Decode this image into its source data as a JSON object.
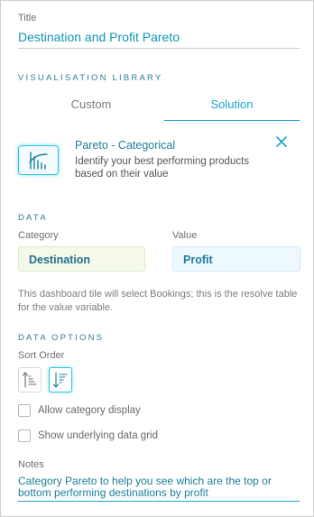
{
  "title": {
    "label": "Title",
    "value": "Destination and Profit Pareto"
  },
  "visualisation": {
    "heading": "VISUALISATION LIBRARY",
    "tabs": [
      {
        "label": "Custom",
        "active": false
      },
      {
        "label": "Solution",
        "active": true
      }
    ],
    "selected": {
      "icon": "pareto-chart-icon",
      "name": "Pareto - Categorical",
      "description": "Identify your best performing products based on their value",
      "close_icon": "close-icon"
    }
  },
  "data": {
    "heading": "DATA",
    "category_label": "Category",
    "category_value": "Destination",
    "value_label": "Value",
    "value_value": "Profit",
    "info": "This dashboard tile will select Bookings; this is the resolve table for the value variable."
  },
  "options": {
    "heading": "DATA OPTIONS",
    "sort_label": "Sort Order",
    "sort_buttons": [
      {
        "icon": "sort-ascending-icon",
        "active": false
      },
      {
        "icon": "sort-descending-icon",
        "active": true
      }
    ],
    "checkboxes": [
      {
        "label": "Allow category display",
        "checked": false
      },
      {
        "label": "Show underlying data grid",
        "checked": false
      }
    ]
  },
  "notes": {
    "label": "Notes",
    "value": "Category Pareto to help you see which are the top or bottom performing destinations by profit"
  },
  "colors": {
    "accent": "#1aa6c7",
    "heading": "#2f7f92",
    "category_bg": "#f4f9ea",
    "value_bg": "#eef9fd"
  }
}
